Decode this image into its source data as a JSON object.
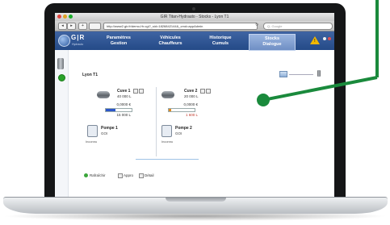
{
  "window": {
    "title": "GIR Titan-Hydrauto - Stocks - Lyon T1"
  },
  "browser": {
    "url": "http://www2.gir.fr/demo-Hr.cgi?_sid=1826842144&_cmd=appAdmin",
    "search_placeholder": "Q- Google",
    "back": "◂",
    "forward": "▸",
    "add": "+"
  },
  "app": {
    "logo": "G|R",
    "logo_sub": "Hydrauto",
    "nav": [
      {
        "line1": "Paramètres",
        "line2": "Gestion"
      },
      {
        "line1": "Véhicules",
        "line2": "Chauffeurs"
      },
      {
        "line1": "Historique",
        "line2": "Cumuls"
      },
      {
        "line1": "Stocks",
        "line2": "Dialogue"
      }
    ],
    "warning": "!",
    "colors": {
      "header": "#2f5597",
      "active_tab": "#8aa7d6",
      "callout": "#1a8a3c"
    }
  },
  "content": {
    "site_title": "Lyon T1",
    "tanks": [
      {
        "name": "Cuve 1",
        "capacity": "40 000 L",
        "amount": "0,0000 €",
        "level": "15 000 L",
        "level_fraction": 0.375,
        "bar_color": "#2b56c9",
        "level_color": "#333333"
      },
      {
        "name": "Cuve 2",
        "capacity": "20 000 L",
        "amount": "0,0000 €",
        "level": "1 600 L",
        "level_fraction": 0.08,
        "bar_color": "#e08a1e",
        "level_color": "#c0392b"
      }
    ],
    "pumps": [
      {
        "name": "Pompe 1",
        "product": "GOI",
        "status": "Inconnu"
      },
      {
        "name": "Pompe 2",
        "product": "GOI",
        "status": "Inconnu"
      }
    ],
    "footer": {
      "refresh": "Rafraîchir",
      "supply": "Appro",
      "detail": "Détail"
    }
  }
}
